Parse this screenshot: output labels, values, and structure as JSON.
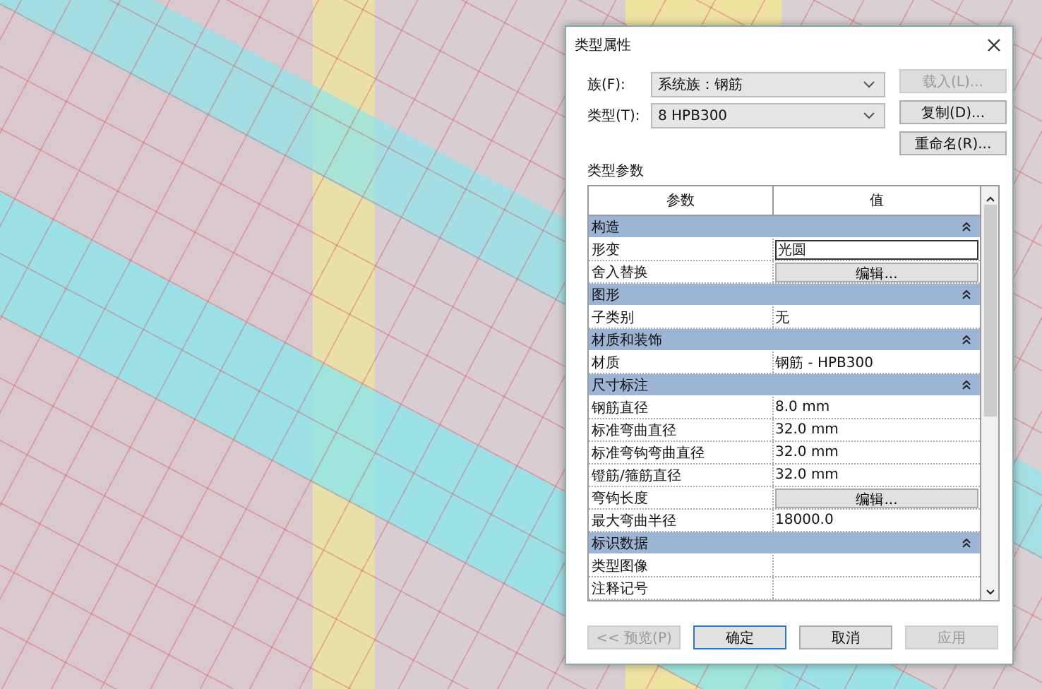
{
  "window": {
    "title": "类型属性"
  },
  "family": {
    "label": "族(F):",
    "value": "系统族：钢筋"
  },
  "type": {
    "label": "类型(T):",
    "value": "8 HPB300"
  },
  "side_buttons": [
    {
      "label": "载入(L)...",
      "disabled": true
    },
    {
      "label": "复制(D)...",
      "disabled": false
    },
    {
      "label": "重命名(R)...",
      "disabled": false
    }
  ],
  "section_label": "类型参数",
  "table": {
    "columns": [
      "参数",
      "值"
    ],
    "groups": [
      {
        "title": "构造",
        "expanded": true,
        "rows": [
          {
            "name": "形变",
            "value": "光圆",
            "kind": "input"
          },
          {
            "name": "舍入替换",
            "value": "编辑...",
            "kind": "button"
          }
        ]
      },
      {
        "title": "图形",
        "expanded": true,
        "rows": [
          {
            "name": "子类别",
            "value": "无",
            "kind": "text"
          }
        ]
      },
      {
        "title": "材质和装饰",
        "expanded": true,
        "rows": [
          {
            "name": "材质",
            "value": "钢筋 - HPB300",
            "kind": "text"
          }
        ]
      },
      {
        "title": "尺寸标注",
        "expanded": true,
        "rows": [
          {
            "name": "钢筋直径",
            "value": "8.0 mm",
            "kind": "text"
          },
          {
            "name": "标准弯曲直径",
            "value": "32.0 mm",
            "kind": "text"
          },
          {
            "name": "标准弯钩弯曲直径",
            "value": "32.0 mm",
            "kind": "text"
          },
          {
            "name": "镫筋/箍筋直径",
            "value": "32.0 mm",
            "kind": "text"
          },
          {
            "name": "弯钩长度",
            "value": "编辑...",
            "kind": "button"
          },
          {
            "name": "最大弯曲半径",
            "value": "18000.0",
            "kind": "text"
          }
        ]
      },
      {
        "title": "标识数据",
        "expanded": true,
        "rows": [
          {
            "name": "类型图像",
            "kind": "text"
          },
          {
            "name": "注释记号",
            "kind": "text"
          }
        ]
      }
    ]
  },
  "footer_buttons": [
    {
      "label": "<< 预览(P)",
      "disabled": true,
      "default": false
    },
    {
      "label": "确定",
      "disabled": false,
      "default": true
    },
    {
      "label": "取消",
      "disabled": false,
      "default": false
    },
    {
      "label": "应用",
      "disabled": true,
      "default": false
    }
  ]
}
